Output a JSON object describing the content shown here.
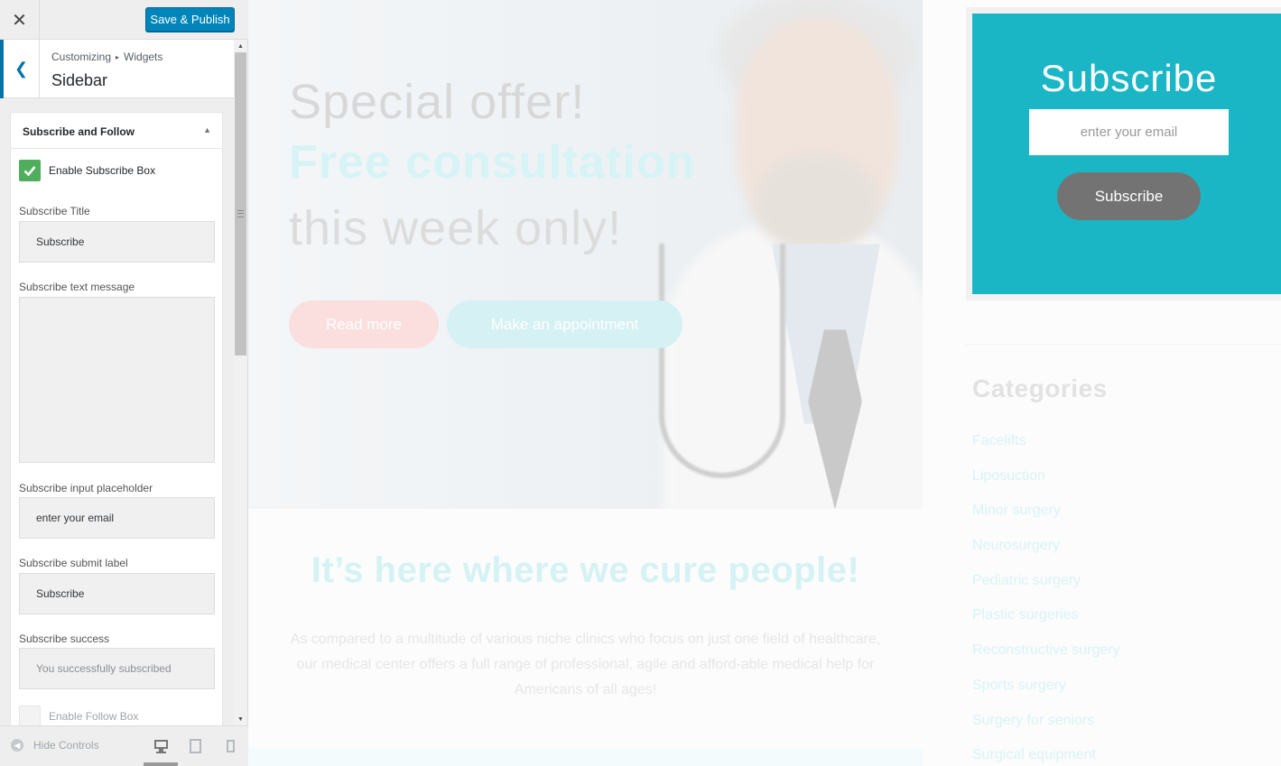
{
  "header": {
    "close_icon": "close-icon",
    "publish_label": "Save & Publish",
    "publish_color": "#0085ba"
  },
  "section": {
    "breadcrumb_root": "Customizing",
    "breadcrumb_current": "Widgets",
    "title": "Sidebar"
  },
  "widget": {
    "title": "Subscribe and Follow",
    "enable_subscribe_label": "Enable Subscribe Box",
    "enable_subscribe_checked": true,
    "fields": {
      "title": {
        "label": "Subscribe Title",
        "value": "Subscribe"
      },
      "message": {
        "label": "Subscribe text message",
        "value": ""
      },
      "placeholder": {
        "label": "Subscribe input placeholder",
        "value": "enter your email"
      },
      "submit": {
        "label": "Subscribe submit label",
        "value": "Subscribe"
      },
      "success": {
        "label": "Subscribe success",
        "value": "You successfully subscribed"
      }
    },
    "enable_follow_label": "Enable Follow Box",
    "enable_follow_checked": false
  },
  "footer": {
    "hide_controls_label": "Hide Controls",
    "devices": [
      "desktop-icon",
      "tablet-icon",
      "mobile-icon"
    ],
    "active_device": "desktop"
  },
  "preview": {
    "hero": {
      "line1": "Special offer!",
      "line2": "Free consultation",
      "line3": "this week only!",
      "read_more": "Read more",
      "appointment": "Make an appointment"
    },
    "cure": {
      "heading": "It’s here where we cure people!",
      "text": "As compared to a multitude of various niche clinics who focus on just one field of healthcare, our medical center offers a full range of professional, agile and afford-able medical help for Americans of all ages!"
    },
    "subscribe": {
      "title": "Subscribe",
      "email_placeholder": "enter your email",
      "button": "Subscribe",
      "color": "#1bb6c6"
    },
    "categories": {
      "title": "Categories",
      "items": [
        "Facelifts",
        "Liposuction",
        "Minor surgery",
        "Neurosurgery",
        "Pediatric surgery",
        "Plastic surgeries",
        "Reconstructive surgery",
        "Sports surgery",
        "Surgery for seniors",
        "Surgical equipment"
      ]
    }
  }
}
